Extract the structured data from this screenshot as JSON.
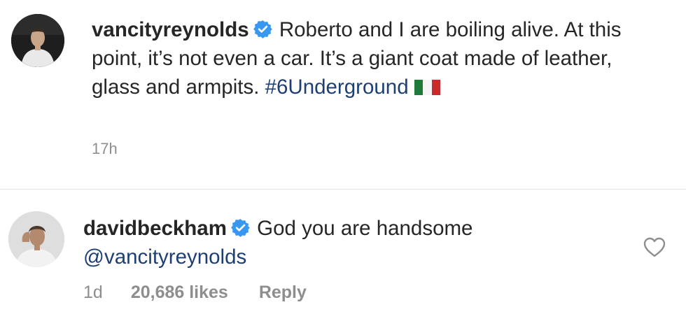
{
  "caption": {
    "username": "vancityreynolds",
    "text": "Roberto and I are boiling alive. At this point, it’s not even a car. It’s a giant coat made of leather, glass and armpits.",
    "hashtag": "#6Underground",
    "flag_icon": "italy-flag-icon",
    "flag_colors": [
      "#1f7a3a",
      "#f4f4f4",
      "#c92a2a"
    ],
    "time": "17h"
  },
  "comment": {
    "username": "davidbeckham",
    "text": "God you are handsome",
    "mention": "@vancityreynolds",
    "time": "1d",
    "likes": "20,686 likes",
    "reply_label": "Reply",
    "like_icon": "heart-outline-icon"
  },
  "colors": {
    "text": "#262626",
    "muted": "#8e8e8e",
    "link": "#1e3f73",
    "verified": "#3897f0",
    "divider": "#e2e2e2"
  }
}
